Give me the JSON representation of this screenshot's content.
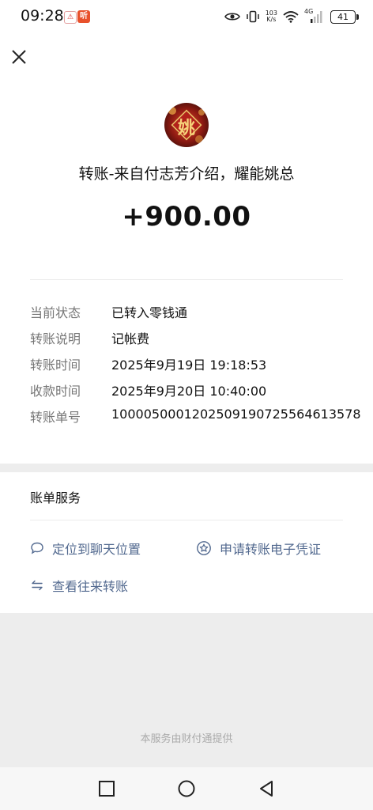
{
  "status_bar": {
    "time": "09:28",
    "notif1_glyph": "⚠",
    "notif2_glyph": "听",
    "net_speed_value": "103",
    "net_speed_unit": "K/s",
    "network": "4G",
    "battery": "41"
  },
  "header": {
    "close_icon": "close-icon"
  },
  "transfer": {
    "avatar_char": "姚",
    "sender": "转账-来自付志芳介绍，耀能姚总",
    "amount": "+900.00"
  },
  "details": [
    {
      "label": "当前状态",
      "value": "已转入零钱通"
    },
    {
      "label": "转账说明",
      "value": "记帐费"
    },
    {
      "label": "转账时间",
      "value": "2025年9月19日 19:18:53"
    },
    {
      "label": "收款时间",
      "value": "2025年9月20日 10:40:00"
    },
    {
      "label": "转账单号",
      "value": "1000050001202509190725564613578"
    }
  ],
  "services": {
    "title": "账单服务",
    "locate_chat": "定位到聊天位置",
    "apply_voucher": "申请转账电子凭证",
    "view_transfers": "查看往来转账"
  },
  "footer": {
    "provider_note": "本服务由财付通提供"
  },
  "colors": {
    "link": "#52698f",
    "background": "#ededed",
    "card": "#ffffff"
  }
}
